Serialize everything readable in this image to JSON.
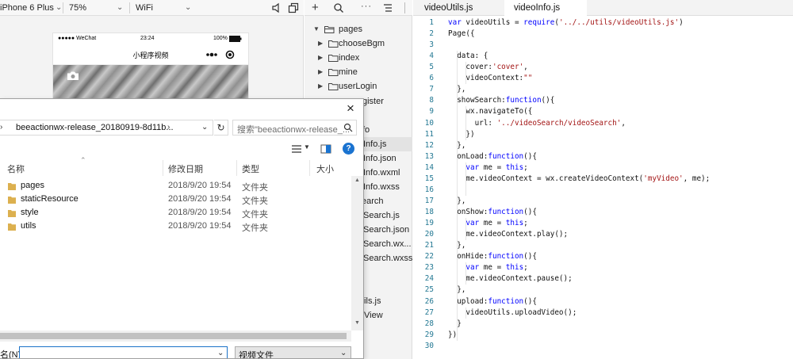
{
  "simulator": {
    "device": "iPhone 6 Plus",
    "zoom": "75%",
    "network": "WiFi",
    "phone": {
      "carrier": "●●●●● WeChat",
      "time": "23:24",
      "battery": "100%",
      "nav_title": "小程序视频"
    }
  },
  "tree": {
    "folders": [
      {
        "label": "pages",
        "expanded": true
      },
      {
        "label": "chooseBgm"
      },
      {
        "label": "index"
      },
      {
        "label": "mine"
      },
      {
        "label": "userLogin"
      }
    ],
    "fragments": [
      "gister",
      "fo",
      "Info.js",
      "Info.json",
      "Info.wxml",
      "Info.wxss",
      "earch",
      "Search.js",
      "Search.json",
      "Search.wx...",
      "Search.wxss",
      "tils.js",
      "View"
    ]
  },
  "editor": {
    "tabs": [
      "videoUtils.js",
      "videoInfo.js"
    ],
    "active_tab": 1,
    "lines": [
      [
        [
          "kw",
          "var"
        ],
        [
          "t",
          " videoUtils = "
        ],
        [
          "kw",
          "require"
        ],
        [
          "t",
          "("
        ],
        [
          "str",
          "'../../utils/videoUtils.js'"
        ],
        [
          "t",
          ")"
        ]
      ],
      [
        [
          "t",
          "Page({"
        ]
      ],
      [],
      [
        [
          "t",
          "  data: {"
        ]
      ],
      [
        [
          "t",
          "    cover:"
        ],
        [
          "str",
          "'cover'"
        ],
        [
          "t",
          ","
        ]
      ],
      [
        [
          "t",
          "    videoContext:"
        ],
        [
          "str",
          "\"\""
        ]
      ],
      [
        [
          "t",
          "  },"
        ]
      ],
      [
        [
          "t",
          "  showSearch:"
        ],
        [
          "kw",
          "function"
        ],
        [
          "t",
          "(){"
        ]
      ],
      [
        [
          "t",
          "    wx.navigateTo({"
        ]
      ],
      [
        [
          "t",
          "      url: "
        ],
        [
          "str",
          "'../videoSearch/videoSearch'"
        ],
        [
          "t",
          ","
        ]
      ],
      [
        [
          "t",
          "    })"
        ]
      ],
      [
        [
          "t",
          "  },"
        ]
      ],
      [
        [
          "t",
          "  onLoad:"
        ],
        [
          "kw",
          "function"
        ],
        [
          "t",
          "(){"
        ]
      ],
      [
        [
          "t",
          "    "
        ],
        [
          "kw",
          "var"
        ],
        [
          "t",
          " me = "
        ],
        [
          "kw",
          "this"
        ],
        [
          "t",
          ";"
        ]
      ],
      [
        [
          "t",
          "    me.videoContext = wx.createVideoContext("
        ],
        [
          "str",
          "'myVideo'"
        ],
        [
          "t",
          ", me);"
        ]
      ],
      [],
      [
        [
          "t",
          "  },"
        ]
      ],
      [
        [
          "t",
          "  onShow:"
        ],
        [
          "kw",
          "function"
        ],
        [
          "t",
          "(){"
        ]
      ],
      [
        [
          "t",
          "    "
        ],
        [
          "kw",
          "var"
        ],
        [
          "t",
          " me = "
        ],
        [
          "kw",
          "this"
        ],
        [
          "t",
          ";"
        ]
      ],
      [
        [
          "t",
          "    me.videoContext.play();"
        ]
      ],
      [
        [
          "t",
          "  },"
        ]
      ],
      [
        [
          "t",
          "  onHide:"
        ],
        [
          "kw",
          "function"
        ],
        [
          "t",
          "(){"
        ]
      ],
      [
        [
          "t",
          "    "
        ],
        [
          "kw",
          "var"
        ],
        [
          "t",
          " me = "
        ],
        [
          "kw",
          "this"
        ],
        [
          "t",
          ";"
        ]
      ],
      [
        [
          "t",
          "    me.videoContext.pause();"
        ]
      ],
      [
        [
          "t",
          "  },"
        ]
      ],
      [
        [
          "t",
          "  upload:"
        ],
        [
          "kw",
          "function"
        ],
        [
          "t",
          "(){"
        ]
      ],
      [
        [
          "t",
          "    videoUtils.uploadVideo();"
        ]
      ],
      [
        [
          "t",
          "  }"
        ]
      ],
      [
        [
          "t",
          "})"
        ]
      ],
      []
    ]
  },
  "dialog": {
    "breadcrumb": "beeactionwx-release_20180919-8d11b...",
    "search_placeholder": "搜索\"beeactionwx-release_...",
    "columns": {
      "name": "名称",
      "date": "修改日期",
      "type": "类型",
      "size": "大小"
    },
    "files": [
      {
        "name": "pages",
        "date": "2018/9/20 19:54",
        "type": "文件夹"
      },
      {
        "name": "staticResource",
        "date": "2018/9/20 19:54",
        "type": "文件夹"
      },
      {
        "name": "style",
        "date": "2018/9/20 19:54",
        "type": "文件夹"
      },
      {
        "name": "utils",
        "date": "2018/9/20 19:54",
        "type": "文件夹"
      }
    ],
    "filename_label": "名(N):",
    "filename_value": "",
    "filetype": "视频文件",
    "help": "?"
  },
  "colors": {
    "keyword": "#0000ff",
    "string": "#a31515",
    "line_number": "#237893",
    "folder": "#dcb04f",
    "help_button": "#1a73d0"
  }
}
